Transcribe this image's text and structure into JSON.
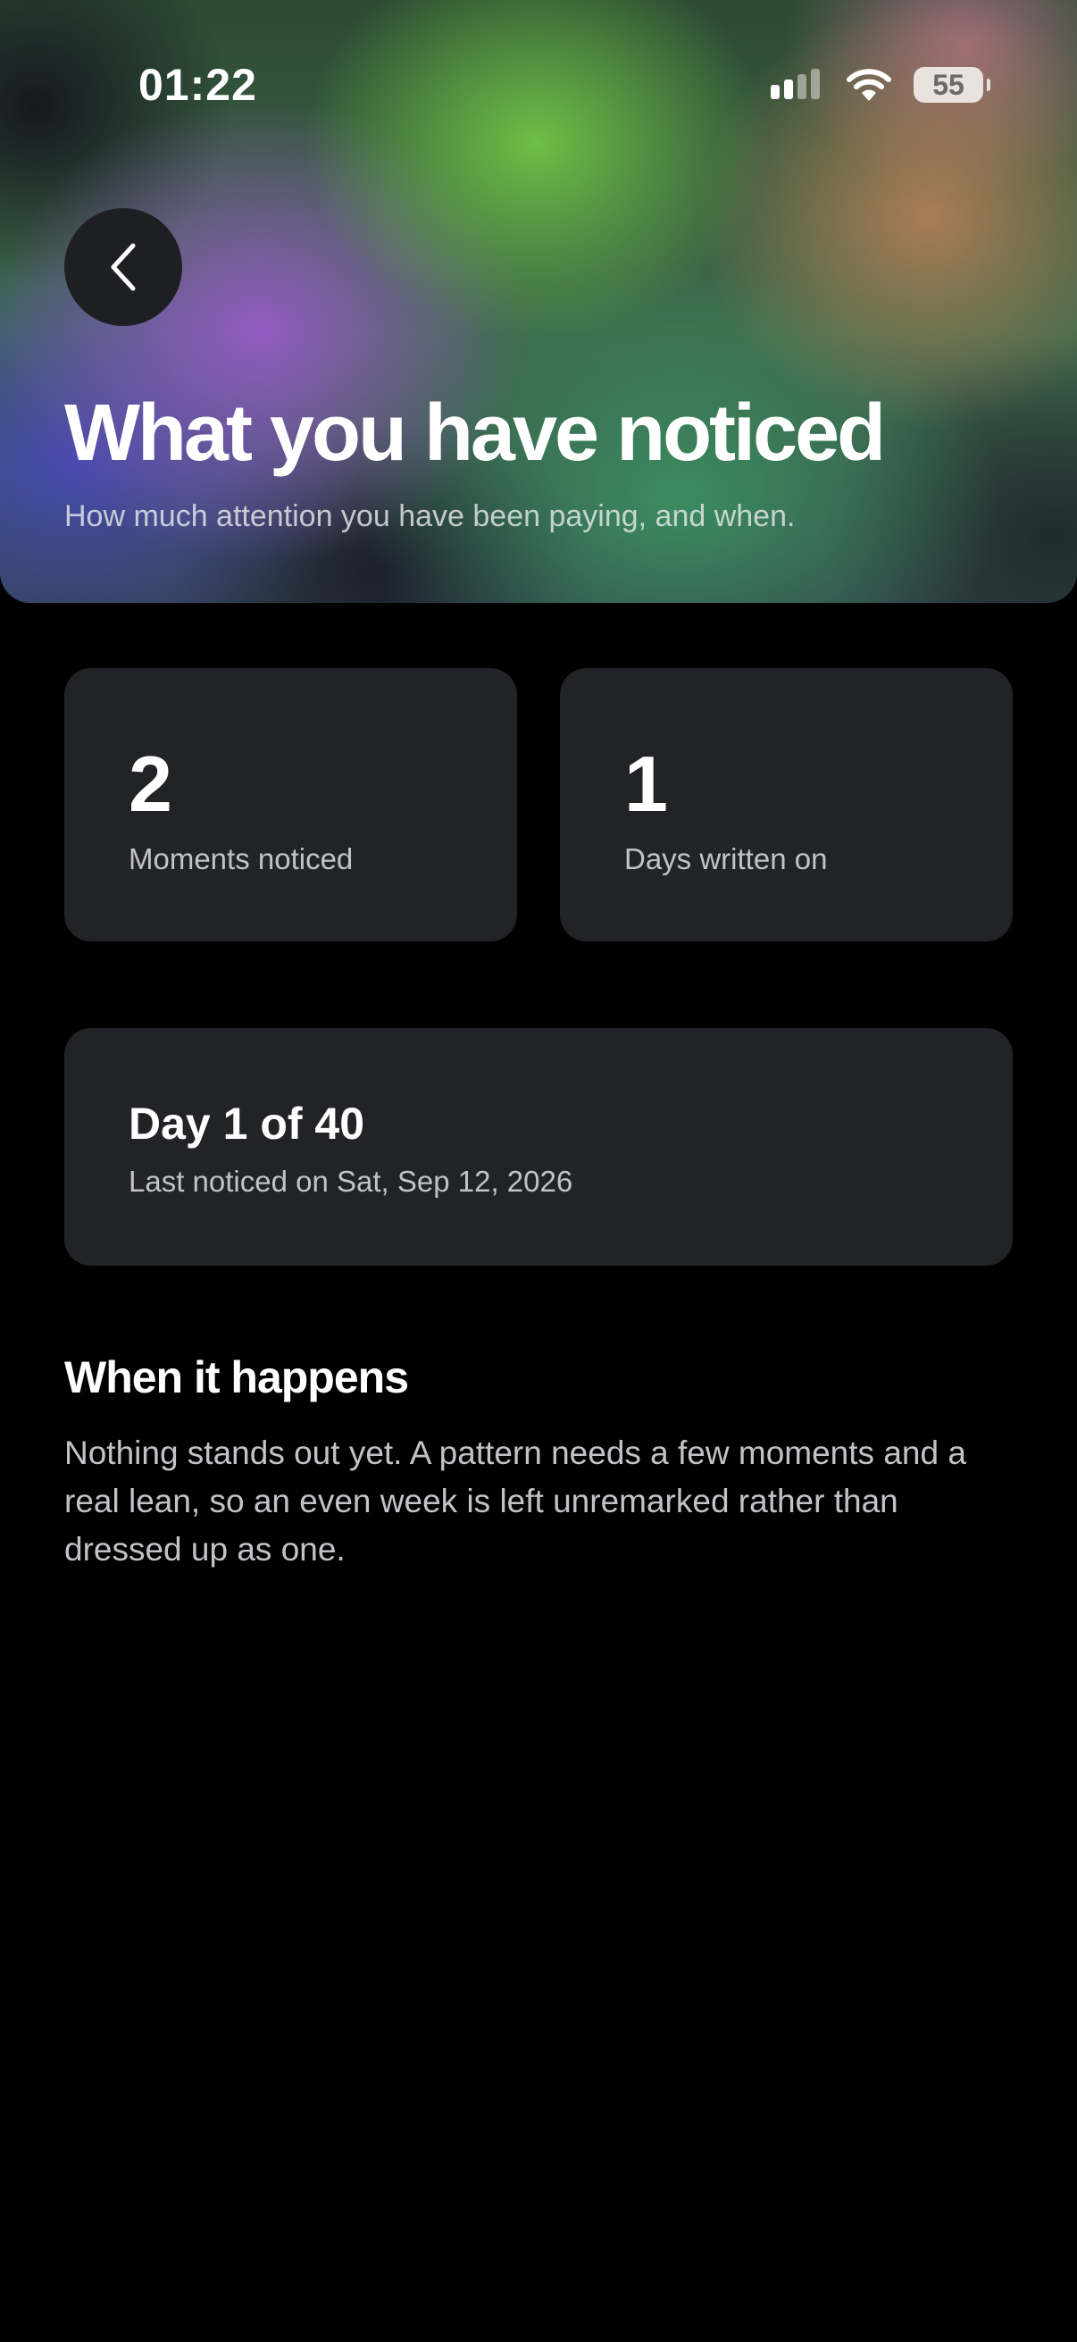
{
  "status_bar": {
    "time": "01:22",
    "battery": "55",
    "icons": [
      "signal-icon",
      "wifi-icon",
      "battery-icon"
    ]
  },
  "header": {
    "back_icon": "chevron-left-icon",
    "title": "What you have noticed",
    "subtitle": "How much attention you have been paying, and when."
  },
  "stats": [
    {
      "value": "2",
      "label": "Moments noticed"
    },
    {
      "value": "1",
      "label": "Days written on"
    }
  ],
  "progress_card": {
    "title": "Day 1 of 40",
    "subtitle": "Last noticed on Sat, Sep 12, 2026"
  },
  "patterns": {
    "heading": "When it happens",
    "body": "Nothing stands out yet. A pattern needs a few moments and a real lean, so an even week is left unremarked rather than dressed up as one."
  },
  "colors": {
    "background": "#000000",
    "card": "#222327",
    "text_primary": "#ffffff",
    "text_secondary": "#c2c3c7",
    "back_button": "#1e1f23"
  }
}
